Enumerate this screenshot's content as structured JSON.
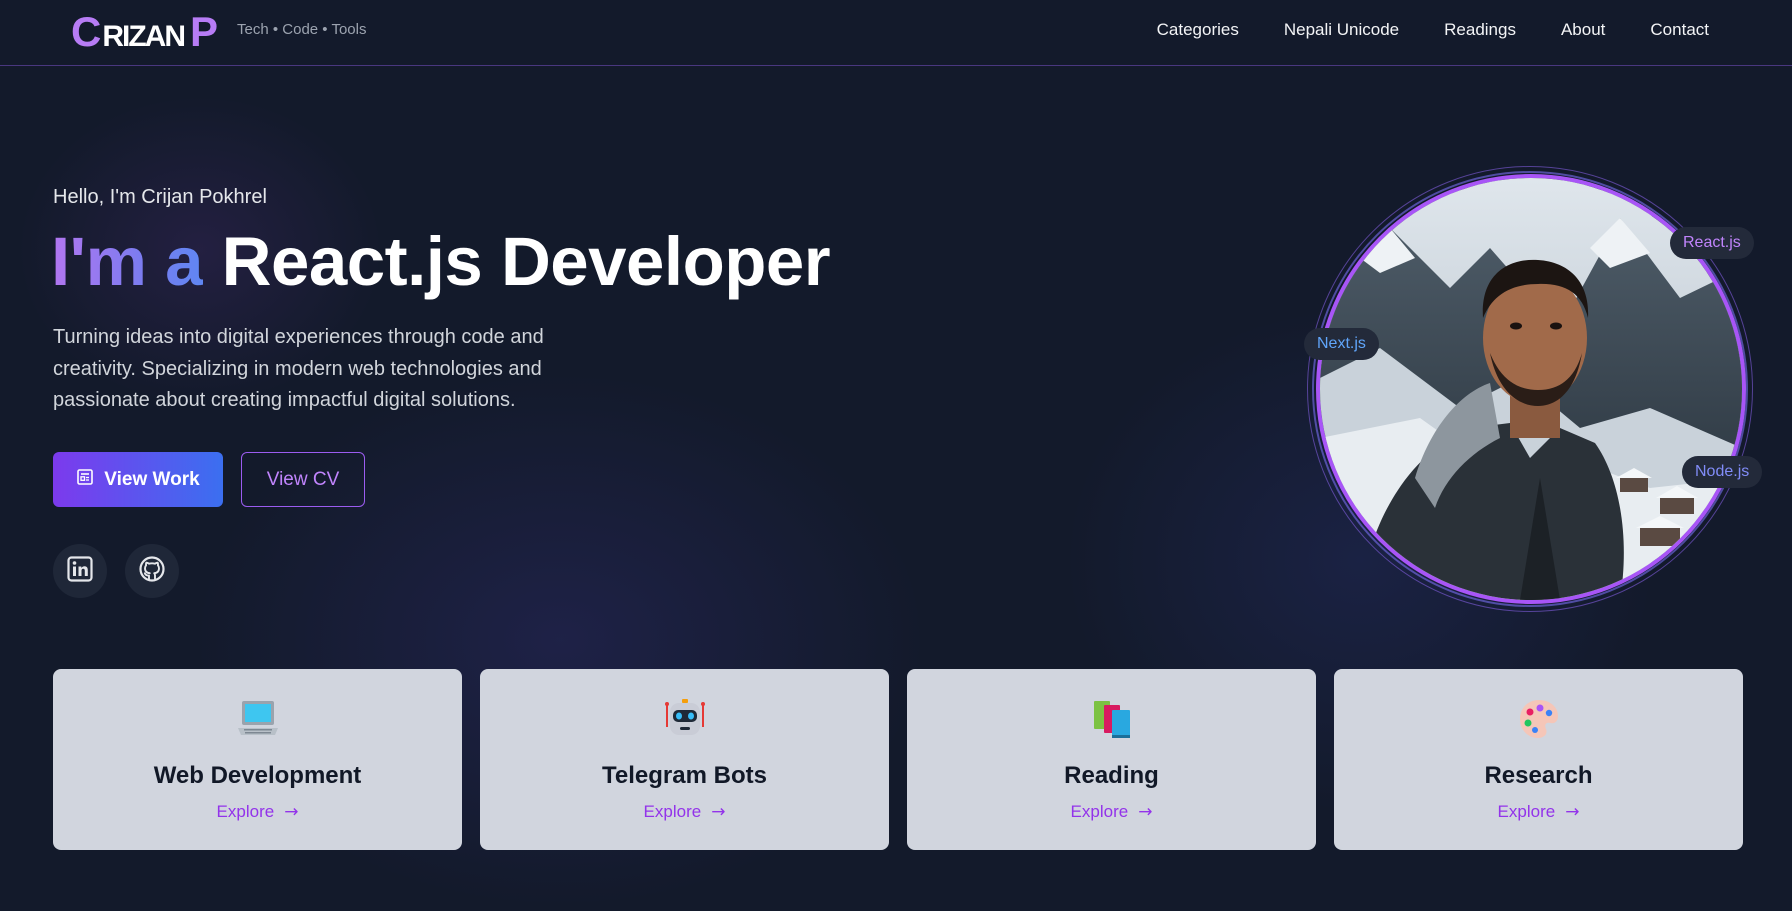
{
  "nav": {
    "logo": {
      "first": "C",
      "middle": "RIZAN",
      "last": "P"
    },
    "tagline": "Tech • Code • Tools",
    "links": [
      "Categories",
      "Nepali Unicode",
      "Readings",
      "About",
      "Contact"
    ]
  },
  "hero": {
    "greeting": "Hello, I'm Crijan Pokhrel",
    "headline_prefix": "I'm a",
    "headline_role": "React.js Developer",
    "description": "Turning ideas into digital experiences through code and creativity. Specializing in modern web technologies and passionate about creating impactful digital solutions.",
    "primary_button": {
      "label": "View Work",
      "icon": "document-icon"
    },
    "secondary_button": {
      "label": "View CV"
    },
    "social": [
      {
        "name": "linkedin",
        "icon": "linkedin-icon"
      },
      {
        "name": "github",
        "icon": "github-icon"
      }
    ],
    "badges": [
      "React.js",
      "Next.js",
      "Node.js"
    ]
  },
  "cards": [
    {
      "icon": "laptop-icon",
      "title": "Web Development",
      "link": "Explore"
    },
    {
      "icon": "robot-icon",
      "title": "Telegram Bots",
      "link": "Explore"
    },
    {
      "icon": "books-icon",
      "title": "Reading",
      "link": "Explore"
    },
    {
      "icon": "palette-icon",
      "title": "Research",
      "link": "Explore"
    }
  ],
  "colors": {
    "background": "#131a2b",
    "accent_purple": "#a855f7",
    "accent_blue": "#3b6ff0",
    "card_background": "#d1d5de",
    "link_purple": "#9333ea"
  }
}
